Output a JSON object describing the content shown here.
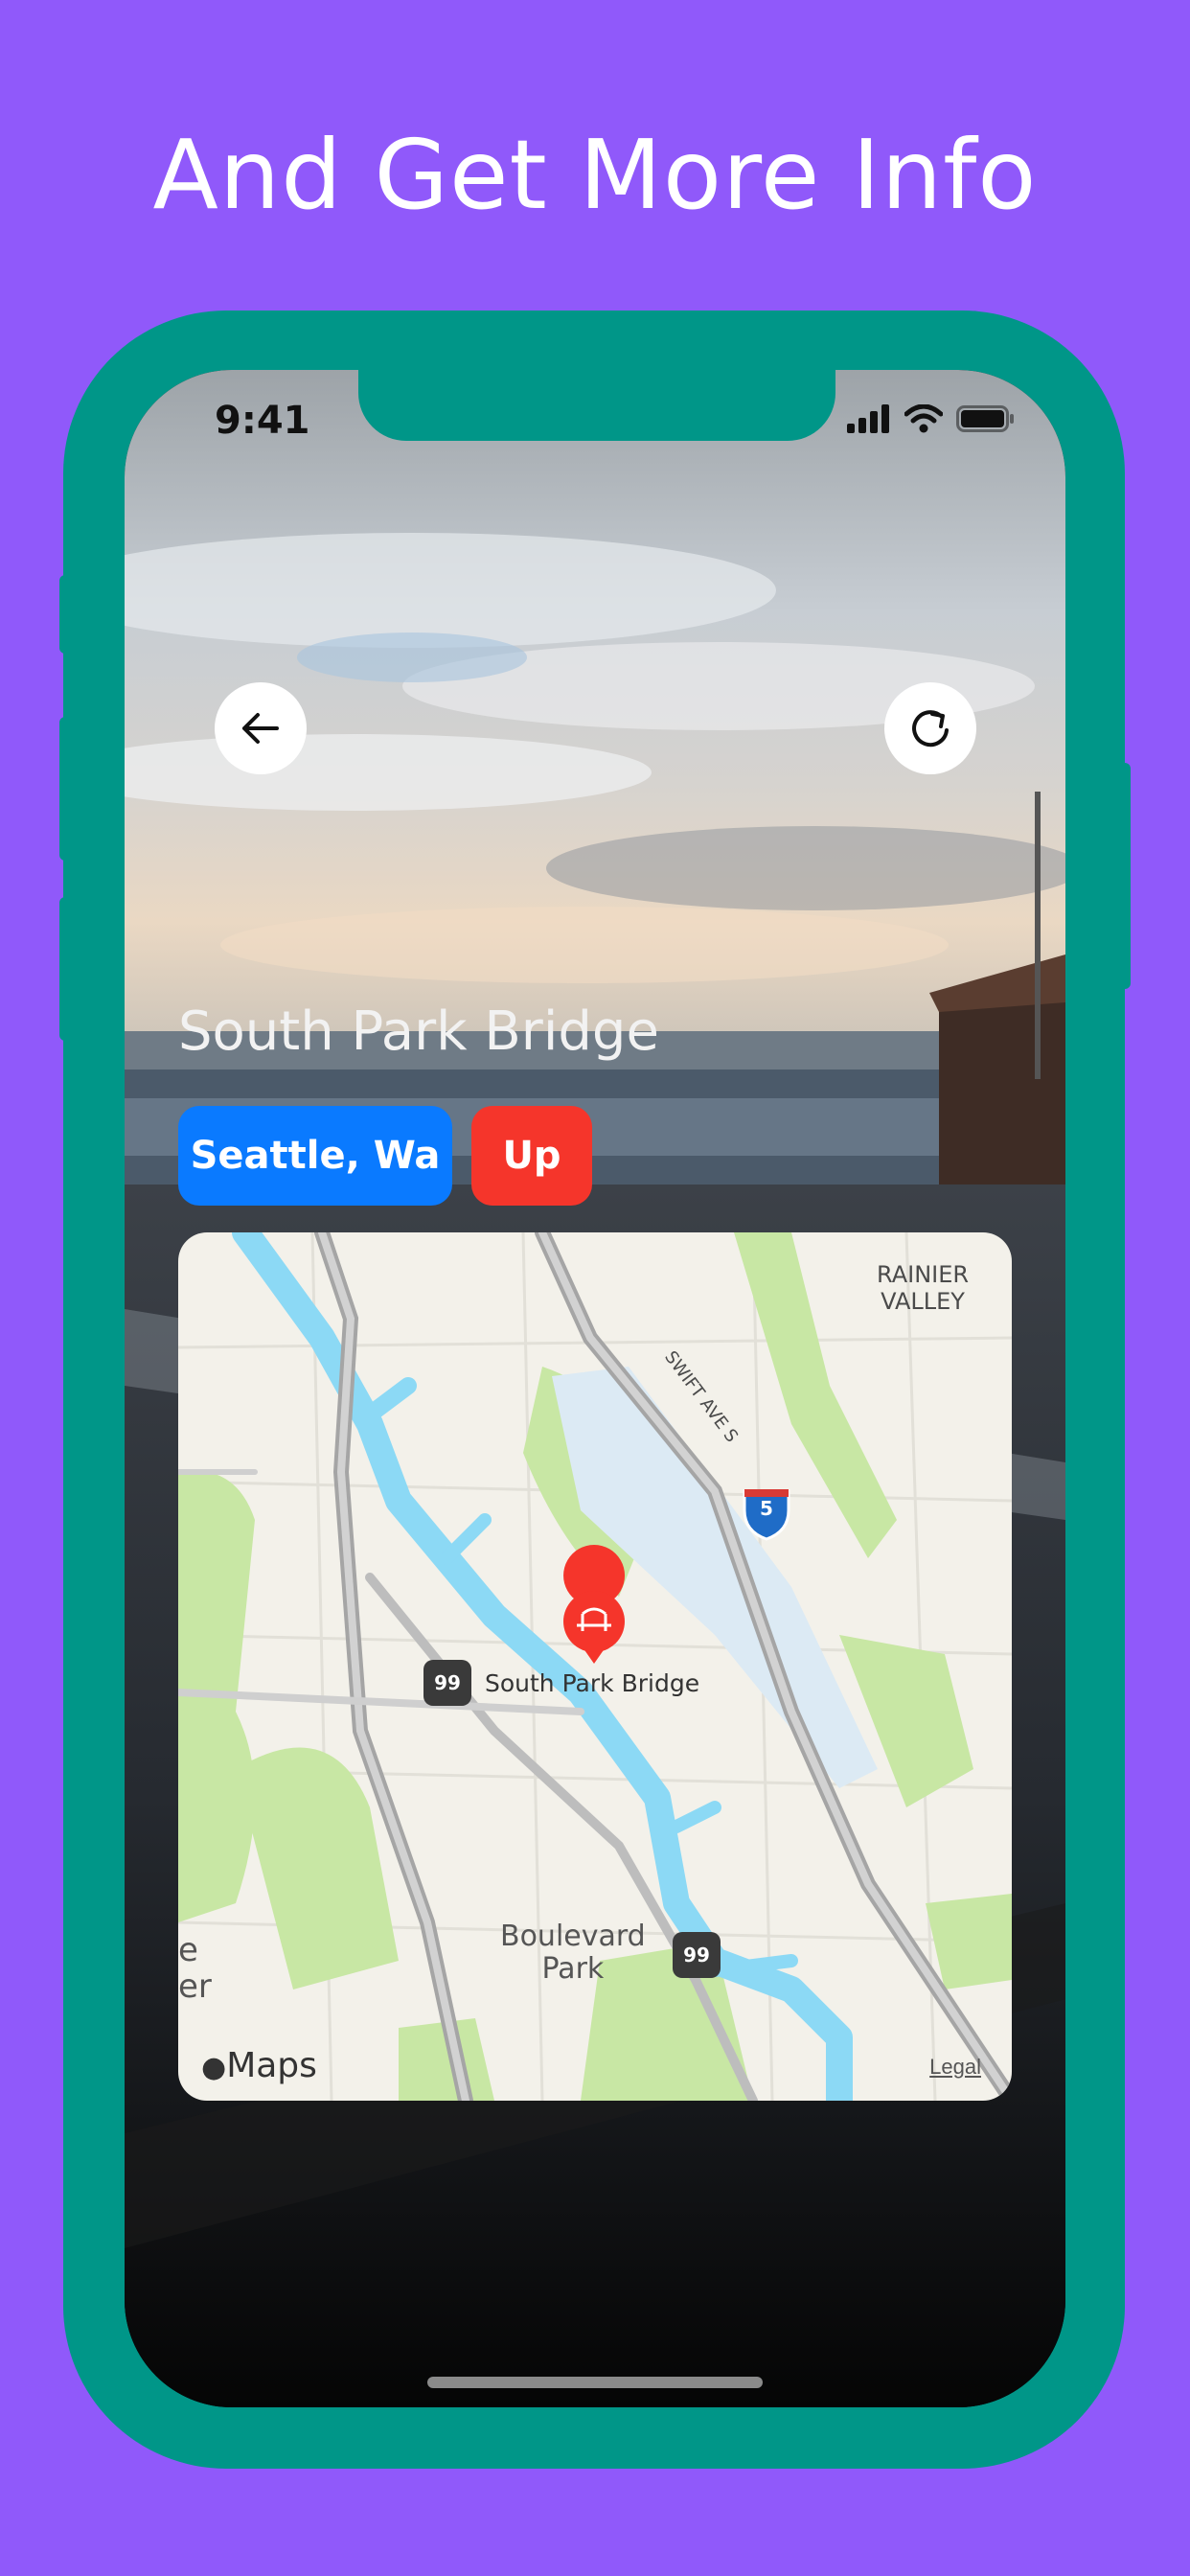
{
  "headline": "And Get More Info",
  "status_bar": {
    "time": "9:41"
  },
  "navigation": {
    "back_icon": "arrow-left-icon",
    "refresh_icon": "refresh-icon"
  },
  "bridge": {
    "name": "South Park Bridge",
    "location": "Seattle, Wa",
    "status": "Up"
  },
  "map": {
    "area_labels": [
      "RAINIER",
      "VALLEY",
      "Boulevard",
      "Park",
      "e",
      "er"
    ],
    "street_label": "SWIFT AVE S",
    "pin_label": "South Park Bridge",
    "route_shields": [
      "99",
      "99",
      "5"
    ],
    "brand": "Maps",
    "legal": "Legal"
  },
  "colors": {
    "background": "#9059FA",
    "frame": "#009688",
    "location_pill": "#0A7AFF",
    "status_pill": "#F5352B",
    "water": "#8CD9F5",
    "park": "#C8E7A4"
  }
}
